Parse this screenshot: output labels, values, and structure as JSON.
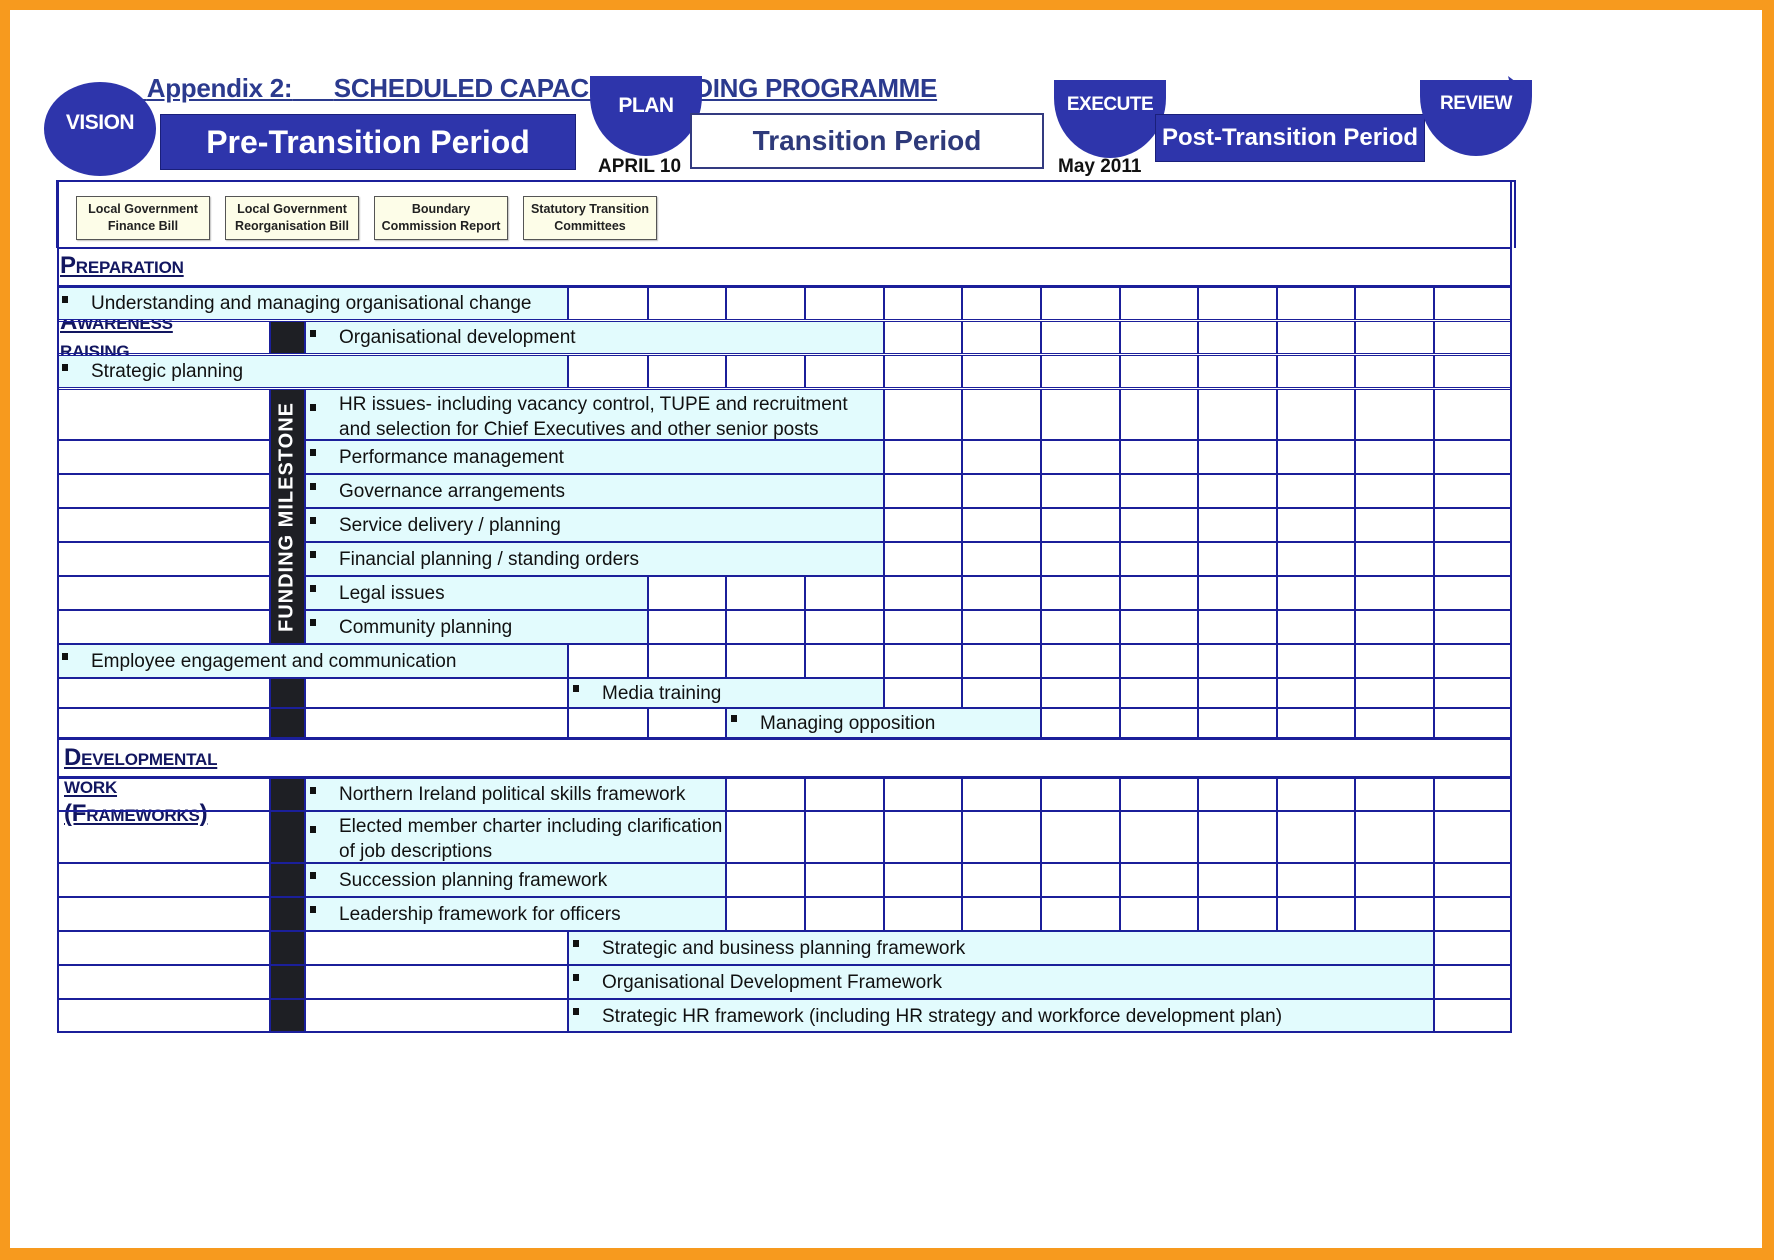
{
  "document": {
    "title_prefix": "Appendix 2:",
    "title": "SCHEDULED CAPACITY BUILDING PROGRAMME"
  },
  "phases": {
    "vision": "VISION",
    "plan": "PLAN",
    "execute": "EXECUTE",
    "review": "REVIEW",
    "pre_transition": "Pre-Transition Period",
    "transition": "Transition Period",
    "post_transition": "Post-Transition Period",
    "plan_date": "APRIL 10",
    "execute_date": "May 2011"
  },
  "legislation": [
    "Local Government\nFinance Bill",
    "Local Government\nReorganisation Bill",
    "Boundary\nCommission Report",
    "Statutory Transition\nCommittees"
  ],
  "milestone_label": "FUNDING MILESTONE",
  "sections": [
    {
      "heading": "Preparation and Awareness raising",
      "rows": [
        {
          "label": "Understanding and managing organisational change",
          "level": "top",
          "span_start": 0,
          "span_end": 6
        },
        {
          "label": "Organisational development",
          "level": "sub",
          "span_start": 3,
          "span_end": 10
        },
        {
          "label": "Strategic planning",
          "level": "top",
          "span_start": 0,
          "span_end": 6
        },
        {
          "label": "HR issues- including vacancy control, TUPE and recruitment and selection for Chief Executives and other senior posts",
          "level": "sub",
          "span_start": 3,
          "span_end": 10
        },
        {
          "label": "Performance management",
          "level": "sub",
          "span_start": 3,
          "span_end": 10
        },
        {
          "label": "Governance arrangements",
          "level": "sub",
          "span_start": 3,
          "span_end": 10
        },
        {
          "label": "Service delivery / planning",
          "level": "sub",
          "span_start": 3,
          "span_end": 10
        },
        {
          "label": "Financial planning / standing orders",
          "level": "sub",
          "span_start": 3,
          "span_end": 10
        },
        {
          "label": "Legal issues",
          "level": "sub",
          "span_start": 3,
          "span_end": 7
        },
        {
          "label": "Community planning",
          "level": "sub",
          "span_start": 3,
          "span_end": 7
        },
        {
          "label": "Employee engagement and communication",
          "level": "top",
          "span_start": 0,
          "span_end": 6
        },
        {
          "label": "Media training",
          "level": "sub",
          "span_start": 6,
          "span_end": 10
        },
        {
          "label": "Managing opposition",
          "level": "sub",
          "span_start": 8,
          "span_end": 12
        }
      ]
    },
    {
      "heading": "Developmental work (Frameworks)",
      "rows": [
        {
          "label": "Northern Ireland political skills framework",
          "level": "sub",
          "span_start": 3,
          "span_end": 8
        },
        {
          "label": "Elected member charter including clarification of job descriptions",
          "level": "sub",
          "span_start": 3,
          "span_end": 8
        },
        {
          "label": "Succession planning framework",
          "level": "sub",
          "span_start": 3,
          "span_end": 8
        },
        {
          "label": "Leadership framework for officers",
          "level": "sub",
          "span_start": 3,
          "span_end": 8
        },
        {
          "label": "Strategic and business planning framework",
          "level": "sub",
          "span_start": 6,
          "span_end": 19
        },
        {
          "label": "Organisational Development Framework",
          "level": "sub",
          "span_start": 6,
          "span_end": 19
        },
        {
          "label": "Strategic HR framework (including HR strategy and workforce development plan)",
          "level": "sub",
          "span_start": 6,
          "span_end": 19
        }
      ]
    }
  ],
  "colors": {
    "accent": "#2e35ab",
    "grid": "#1b1f9a",
    "band": "#e2fbfd",
    "milestone": "#1e1f24",
    "frame": "#f79a1e"
  }
}
